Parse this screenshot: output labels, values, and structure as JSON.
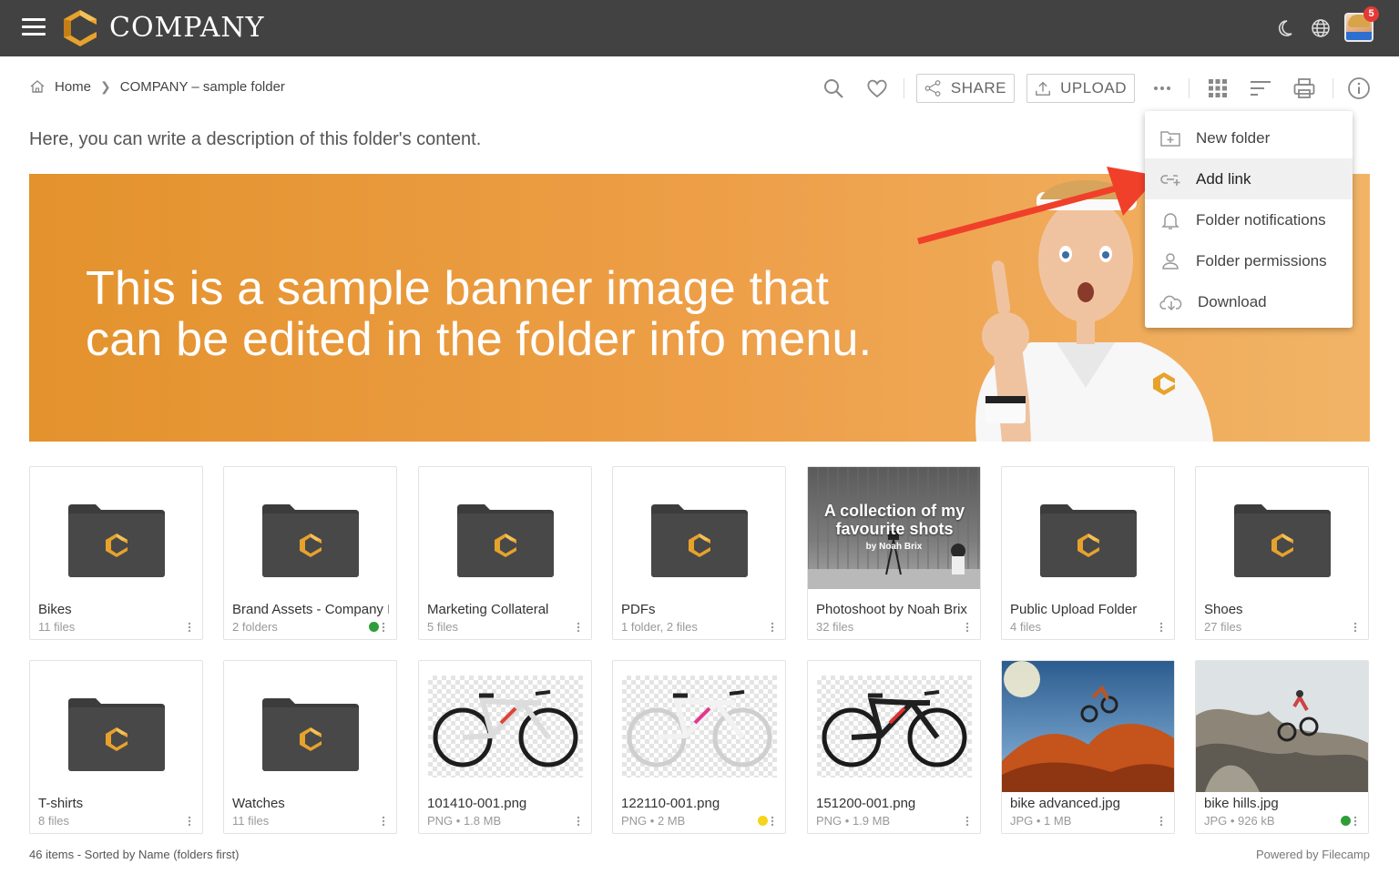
{
  "app": {
    "brand": "COMPANY",
    "notification_count": "5"
  },
  "breadcrumb": {
    "home": "Home",
    "current": "COMPANY – sample folder"
  },
  "toolbar": {
    "share_label": "SHARE",
    "upload_label": "UPLOAD"
  },
  "description": "Here, you can write a description of this folder's content.",
  "banner": {
    "line1": "This is a sample banner image that",
    "line2": "can be edited in the folder info menu."
  },
  "menu": {
    "items": [
      {
        "label": "New folder",
        "icon": "new-folder-icon"
      },
      {
        "label": "Add link",
        "icon": "link-icon"
      },
      {
        "label": "Folder notifications",
        "icon": "bell-icon"
      },
      {
        "label": "Folder permissions",
        "icon": "person-icon"
      },
      {
        "label": "Download",
        "icon": "cloud-download-icon"
      }
    ]
  },
  "items": [
    {
      "name": "Bikes",
      "meta": "11 files",
      "type": "folder"
    },
    {
      "name": "Brand Assets - Company Im",
      "meta": "2 folders",
      "type": "folder",
      "status": "green"
    },
    {
      "name": "Marketing Collateral",
      "meta": "5 files",
      "type": "folder"
    },
    {
      "name": "PDFs",
      "meta": "1 folder, 2 files",
      "type": "folder"
    },
    {
      "name": "Photoshoot by Noah Brix",
      "meta": "32 files",
      "type": "folder-cover",
      "cover_title": "A collection of my favourite shots",
      "cover_sub": "by Noah Brix"
    },
    {
      "name": "Public Upload Folder",
      "meta": "4 files",
      "type": "folder"
    },
    {
      "name": "Shoes",
      "meta": "27 files",
      "type": "folder"
    },
    {
      "name": "T-shirts",
      "meta": "8 files",
      "type": "folder"
    },
    {
      "name": "Watches",
      "meta": "11 files",
      "type": "folder"
    },
    {
      "name": "101410-001.png",
      "meta": "PNG • 1.8 MB",
      "type": "image"
    },
    {
      "name": "122110-001.png",
      "meta": "PNG • 2 MB",
      "type": "image",
      "status": "yellow"
    },
    {
      "name": "151200-001.png",
      "meta": "PNG • 1.9 MB",
      "type": "image"
    },
    {
      "name": "bike advanced.jpg",
      "meta": "JPG • 1 MB",
      "type": "photo"
    },
    {
      "name": "bike hills.jpg",
      "meta": "JPG • 926 kB",
      "type": "photo",
      "status": "green"
    }
  ],
  "footer": {
    "left": "46 items - Sorted by Name (folders first)",
    "right": "Powered by Filecamp"
  },
  "colors": {
    "topbar": "#424242",
    "accent": "#e3922c",
    "arrow": "#f0402a",
    "green": "#2e9e3a",
    "yellow": "#f5d41a"
  }
}
